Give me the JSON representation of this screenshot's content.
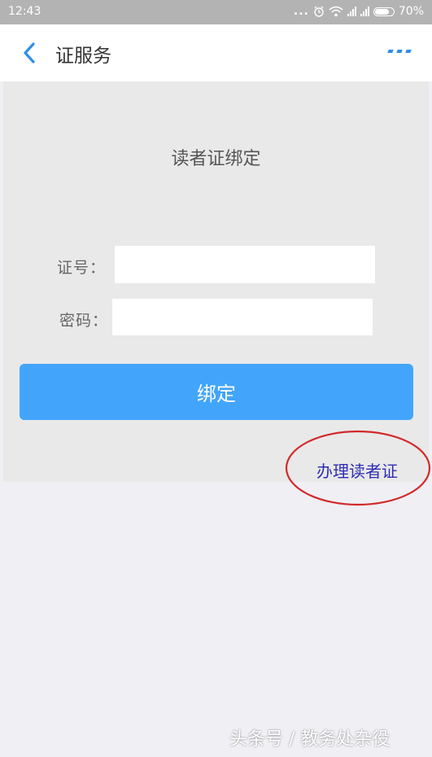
{
  "status_bar": {
    "time": "12:43",
    "dots": "...",
    "battery_percent": "70%"
  },
  "nav": {
    "title": "证服务"
  },
  "form": {
    "title": "读者证绑定",
    "card_number_label": "证号：",
    "password_label": "密码：",
    "card_number_value": "",
    "password_value": "",
    "bind_label": "绑定",
    "apply_link": "办理读者证"
  },
  "watermark": "头条号 / 教务处杂役",
  "colors": {
    "accent": "#42a5fb",
    "link": "#2e2eb4",
    "highlight": "#d12a2a",
    "nav_icon": "#2f8ee8"
  }
}
